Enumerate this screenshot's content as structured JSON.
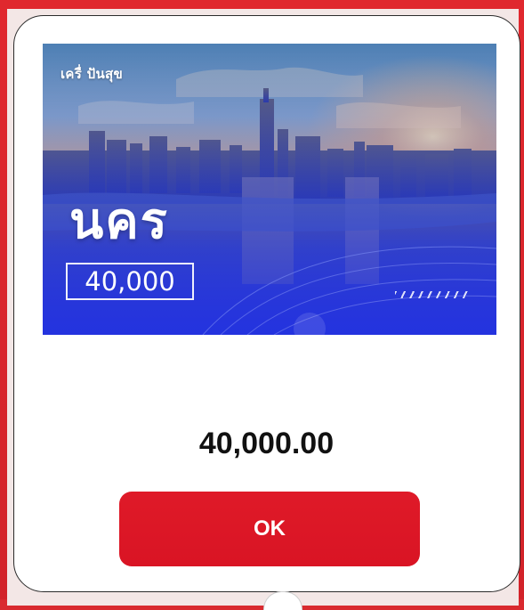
{
  "banner": {
    "brand": "เครื่ ปันสุข",
    "city": "นคร",
    "amount": "40,000",
    "image_description": "city-skyline-photo"
  },
  "dialog": {
    "amount_value": "40,000.00",
    "ok_label": "OK"
  },
  "colors": {
    "backdrop": "#d92a2f",
    "button": "#dc1726",
    "button_text": "#ffffff",
    "amount_text": "#111111",
    "banner_blue": "#2f42dc"
  }
}
